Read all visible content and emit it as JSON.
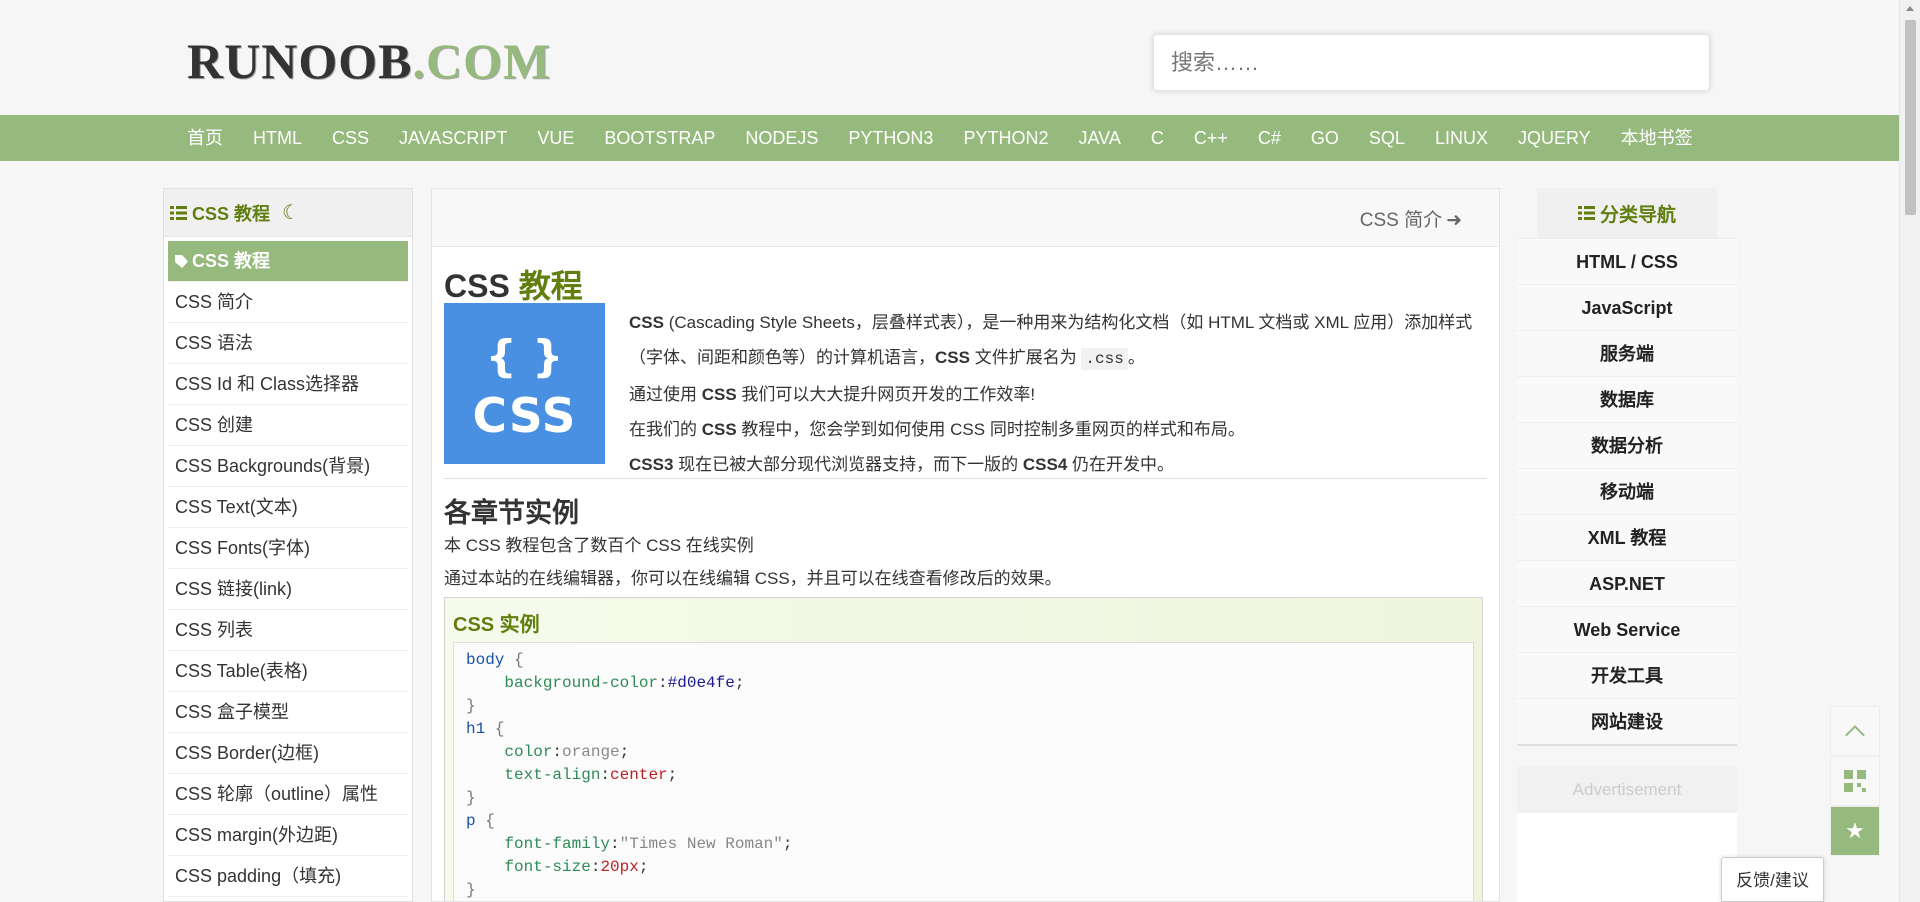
{
  "header": {
    "logo_main": "RUNOOB",
    "logo_dot": ".COM",
    "search_placeholder": "搜索……"
  },
  "nav": {
    "items": [
      "首页",
      "HTML",
      "CSS",
      "JAVASCRIPT",
      "VUE",
      "BOOTSTRAP",
      "NODEJS",
      "PYTHON3",
      "PYTHON2",
      "JAVA",
      "C",
      "C++",
      "C#",
      "GO",
      "SQL",
      "LINUX",
      "JQUERY",
      "本地书签"
    ]
  },
  "left_sidebar": {
    "title": "CSS 教程",
    "items": [
      "CSS 教程",
      "CSS 简介",
      "CSS 语法",
      "CSS Id 和 Class选择器",
      "CSS 创建",
      "CSS Backgrounds(背景)",
      "CSS Text(文本)",
      "CSS Fonts(字体)",
      "CSS 链接(link)",
      "CSS 列表",
      "CSS Table(表格)",
      "CSS 盒子模型",
      "CSS Border(边框)",
      "CSS 轮廓（outline）属性",
      "CSS margin(外边距)",
      "CSS padding（填充)"
    ]
  },
  "main": {
    "next_link": "CSS 简介",
    "title_prefix": "CSS",
    "title_highlight": "教程",
    "logo_braces": "{ }",
    "logo_word": "CSS",
    "intro": {
      "p1_b": "CSS",
      "p1_text": " (Cascading Style Sheets，层叠样式表），是一种用来为结构化文档（如 HTML 文档或 XML 应用）添加样式（字体、间距和颜色等）的计算机语言，",
      "p1_b2": "CSS",
      "p1_text2": " 文件扩展名为 ",
      "p1_code": ".css",
      "p1_end": "。",
      "p2_pre": "通过使用 ",
      "p2_b": "CSS",
      "p2_post": " 我们可以大大提升网页开发的工作效率!",
      "p3_pre": "在我们的 ",
      "p3_b": "CSS",
      "p3_post": " 教程中，您会学到如何使用 CSS 同时控制多重网页的样式和布局。",
      "p4_b": "CSS3",
      "p4_mid": " 现在已被大部分现代浏览器支持，而下一版的 ",
      "p4_b2": "CSS4",
      "p4_post": " 仍在开发中。"
    },
    "section_title": "各章节实例",
    "section_p1": "本 CSS 教程包含了数百个 CSS 在线实例",
    "section_p2": "通过本站的在线编辑器，你可以在线编辑 CSS，并且可以在线查看修改后的效果。",
    "example_title": "CSS 实例",
    "code": {
      "l1_sel": "body",
      "l2_prop": "background-color",
      "l2_val": "#d0e4fe",
      "l4_sel": "h1",
      "l5_prop": "color",
      "l5_val": "orange",
      "l6_prop": "text-align",
      "l6_val": "center",
      "l8_sel": "p",
      "l9_prop": "font-family",
      "l9_val": "\"Times New Roman\"",
      "l10_prop": "font-size",
      "l10_val": "20px"
    }
  },
  "right_sidebar": {
    "title": "分类导航",
    "items": [
      "HTML / CSS",
      "JavaScript",
      "服务端",
      "数据库",
      "数据分析",
      "移动端",
      "XML 教程",
      "ASP.NET",
      "Web Service",
      "开发工具",
      "网站建设"
    ],
    "ad_label": "Advertisement"
  },
  "feedback": "反馈/建议",
  "colors": {
    "accent": "#96b97d",
    "accent_dark": "#617f10"
  }
}
